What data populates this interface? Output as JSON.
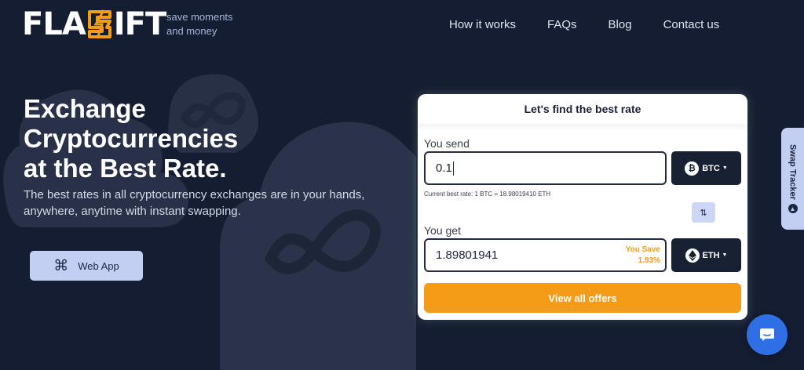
{
  "brand": {
    "logo_left": "FLA",
    "logo_right": "IFT",
    "logo_accent_color": "#f39c17",
    "tagline_line1": "save moments",
    "tagline_line2": "and money"
  },
  "nav": {
    "items": [
      "How it works",
      "FAQs",
      "Blog",
      "Contact us"
    ]
  },
  "hero": {
    "title_line1": "Exchange",
    "title_line2": "Cryptocurrencies",
    "title_line3": "at the Best Rate.",
    "subtitle": "The best rates in all cryptocurrency exchanges are in your hands, anywhere, anytime with instant swapping.",
    "webapp_icon": "command-icon",
    "webapp_label": "Web App"
  },
  "exchange": {
    "header": "Let's find the best rate",
    "send_label": "You send",
    "send_value": "0.1",
    "send_coin": "BTC",
    "send_coin_icon": "bitcoin-icon",
    "rate_text": "Current best rate: 1 BTC = 18.98019410 ETH",
    "swap_icon": "swap-arrows-icon",
    "get_label": "You get",
    "get_value": "1.89801941",
    "save_label": "You Save",
    "save_value": "1.93%",
    "get_coin": "ETH",
    "get_coin_icon": "ethereum-icon",
    "offers_button": "View all offers"
  },
  "tracker": {
    "label": "Swap Tracker"
  },
  "colors": {
    "background": "#141d31",
    "accent": "#f49c18",
    "button_light": "#c3cef3",
    "chat": "#2f6fe6"
  }
}
